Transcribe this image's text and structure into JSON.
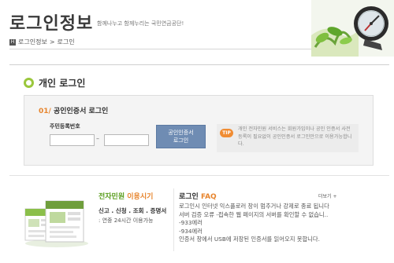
{
  "header": {
    "title": "로그인정보",
    "subtitle": "함께나누고 함께누리는 국민연금공단!",
    "breadcrumb": [
      "로그인정보",
      "로그인"
    ],
    "breadcrumb_separator": ">"
  },
  "login": {
    "heading": "개인 로그인",
    "step_number": "01/",
    "step_title": "공인인증서 로그인",
    "id_label": "주민등록번호",
    "id_first_value": "",
    "id_second_value": "",
    "dash": "–",
    "button_line1": "공인인증서",
    "button_line2": "로그인",
    "tip_badge": "TIP",
    "tip_text": "개인 전자민원 서비스는 회원가입이나 공인 인증서 사전 등록이 필요없이 공인인증서 로그인만으로 이용가능합니다."
  },
  "promo": {
    "title_green": "전자민원",
    "title_orange": " 이용시기",
    "services": "신고 . 신청 . 조회 . 증명서",
    "hours": ": 연중 24시간 이용가능"
  },
  "faq": {
    "title_main": "로그인",
    "title_accent": " FAQ",
    "more_label": "더보기 +",
    "items": [
      "로그인시 인터넷 익스플로러 창이 멈추거나 강제로 종료 됩니다",
      "서버 검증 오류 -접속한 웹 페이지의 서버를 확인할 수 없습니..",
      "-933에러",
      "-934에러",
      "인증서 창에서 USB에 저장된 인증서를 읽어오지 못합니다."
    ]
  },
  "colors": {
    "accent_green": "#9ac73c",
    "accent_orange": "#e7842c",
    "button_blue": "#6f8cb3"
  }
}
